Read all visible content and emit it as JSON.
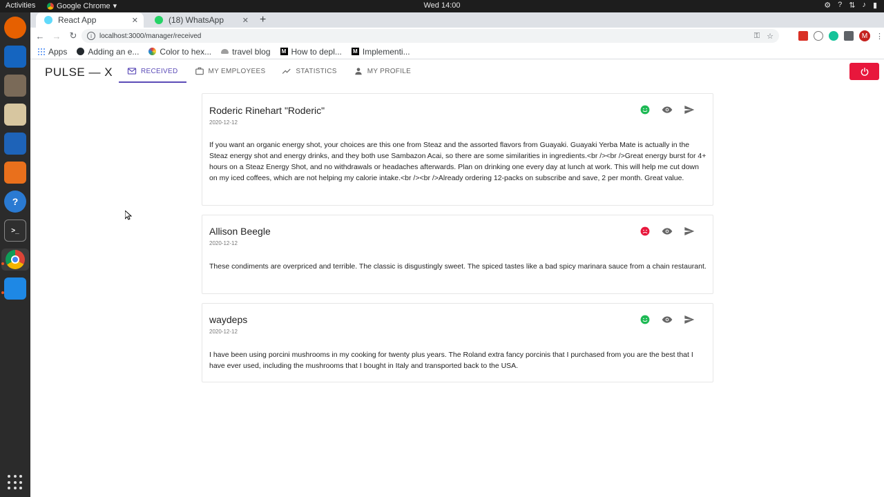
{
  "system": {
    "activities": "Activities",
    "app_name": "Google Chrome",
    "clock": "Wed 14:00"
  },
  "browser": {
    "tabs": [
      {
        "title": "React App",
        "active": true
      },
      {
        "title": "(18) WhatsApp",
        "active": false
      }
    ],
    "url": "localhost:3000/manager/received",
    "bookmarks": [
      {
        "label": "Apps",
        "icon": "apps-grid-icon"
      },
      {
        "label": "Adding an e...",
        "icon": "github-icon"
      },
      {
        "label": "Color to hex...",
        "icon": "palette-icon"
      },
      {
        "label": "travel blog",
        "icon": "cloud-icon"
      },
      {
        "label": "How to depl...",
        "icon": "medium-icon"
      },
      {
        "label": "Implementi...",
        "icon": "medium-icon"
      }
    ]
  },
  "app": {
    "brand": "PULSE — X",
    "nav": [
      {
        "label": "RECEIVED",
        "icon": "mail-icon",
        "active": true
      },
      {
        "label": "MY EMPLOYEES",
        "icon": "briefcase-icon",
        "active": false
      },
      {
        "label": "STATISTICS",
        "icon": "trending-up-icon",
        "active": false
      },
      {
        "label": "MY PROFILE",
        "icon": "person-icon",
        "active": false
      }
    ],
    "accent_color": "#5b4bb7",
    "logout_color": "#e8173c",
    "feedback": [
      {
        "author": "Roderic Rinehart \"Roderic\"",
        "date": "2020-12-12",
        "sentiment": "positive",
        "text": "If you want an organic energy shot, your choices are this one from Steaz and the assorted flavors from Guayaki. Guayaki Yerba Mate is actually in the Steaz energy shot and energy drinks, and they both use Sambazon Acai, so there are some similarities in ingredients.<br /><br />Great energy burst for 4+ hours on a Steaz Energy Shot, and no withdrawals or headaches afterwards. Plan on drinking one every day at lunch at work. This will help me cut down on my iced coffees, which are not helping my calorie intake.<br /><br />Already ordering 12-packs on subscribe and save, 2 per month. Great value."
      },
      {
        "author": "Allison Beegle",
        "date": "2020-12-12",
        "sentiment": "negative",
        "text": "These condiments are overpriced and terrible. The classic is disgustingly sweet. The spiced tastes like a bad spicy marinara sauce from a chain restaurant."
      },
      {
        "author": "waydeps",
        "date": "2020-12-12",
        "sentiment": "positive",
        "text": "I have been using porcini mushrooms in my cooking for twenty plus years. The Roland extra fancy porcinis that I purchased from you are the best that I have ever used, including the mushrooms that I bought in Italy and transported back to the USA."
      }
    ],
    "sentiment_colors": {
      "positive": "#1db954",
      "negative": "#e8173c"
    }
  }
}
